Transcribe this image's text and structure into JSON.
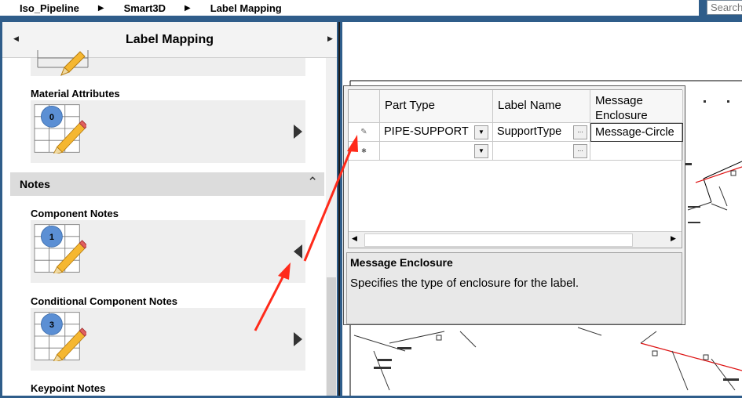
{
  "breadcrumb": [
    "Iso_Pipeline",
    "Smart3D",
    "Label Mapping"
  ],
  "search": {
    "placeholder": "Search"
  },
  "left_panel": {
    "title": "Label Mapping",
    "sections": {
      "material_attributes": {
        "label": "Material Attributes",
        "count": "0"
      },
      "notes_header": "Notes",
      "component_notes": {
        "label": "Component Notes",
        "count": "1"
      },
      "conditional_component_notes": {
        "label": "Conditional Component Notes",
        "count": "3"
      },
      "keypoint_notes": {
        "label": "Keypoint Notes"
      }
    }
  },
  "dialog": {
    "columns": [
      "Part Type",
      "Label Name",
      "Message Enclosure"
    ],
    "rows": [
      {
        "part_type": "PIPE-SUPPORT",
        "label_name": "SupportType",
        "message_enclosure": "Message-Circle"
      }
    ],
    "description": {
      "title": "Message Enclosure",
      "text": "Specifies the type of enclosure for the label."
    }
  },
  "colors": {
    "arrow": "#ff2a1a",
    "chrome_blue": "#2f5d8a",
    "badge_blue": "#5b8fd4"
  },
  "icons": [
    "chevron-left-icon",
    "chevron-right-icon",
    "collapse-up-icon",
    "play-right-icon",
    "play-left-icon",
    "pencil-icon",
    "dropdown-icon",
    "ellipsis-icon"
  ]
}
